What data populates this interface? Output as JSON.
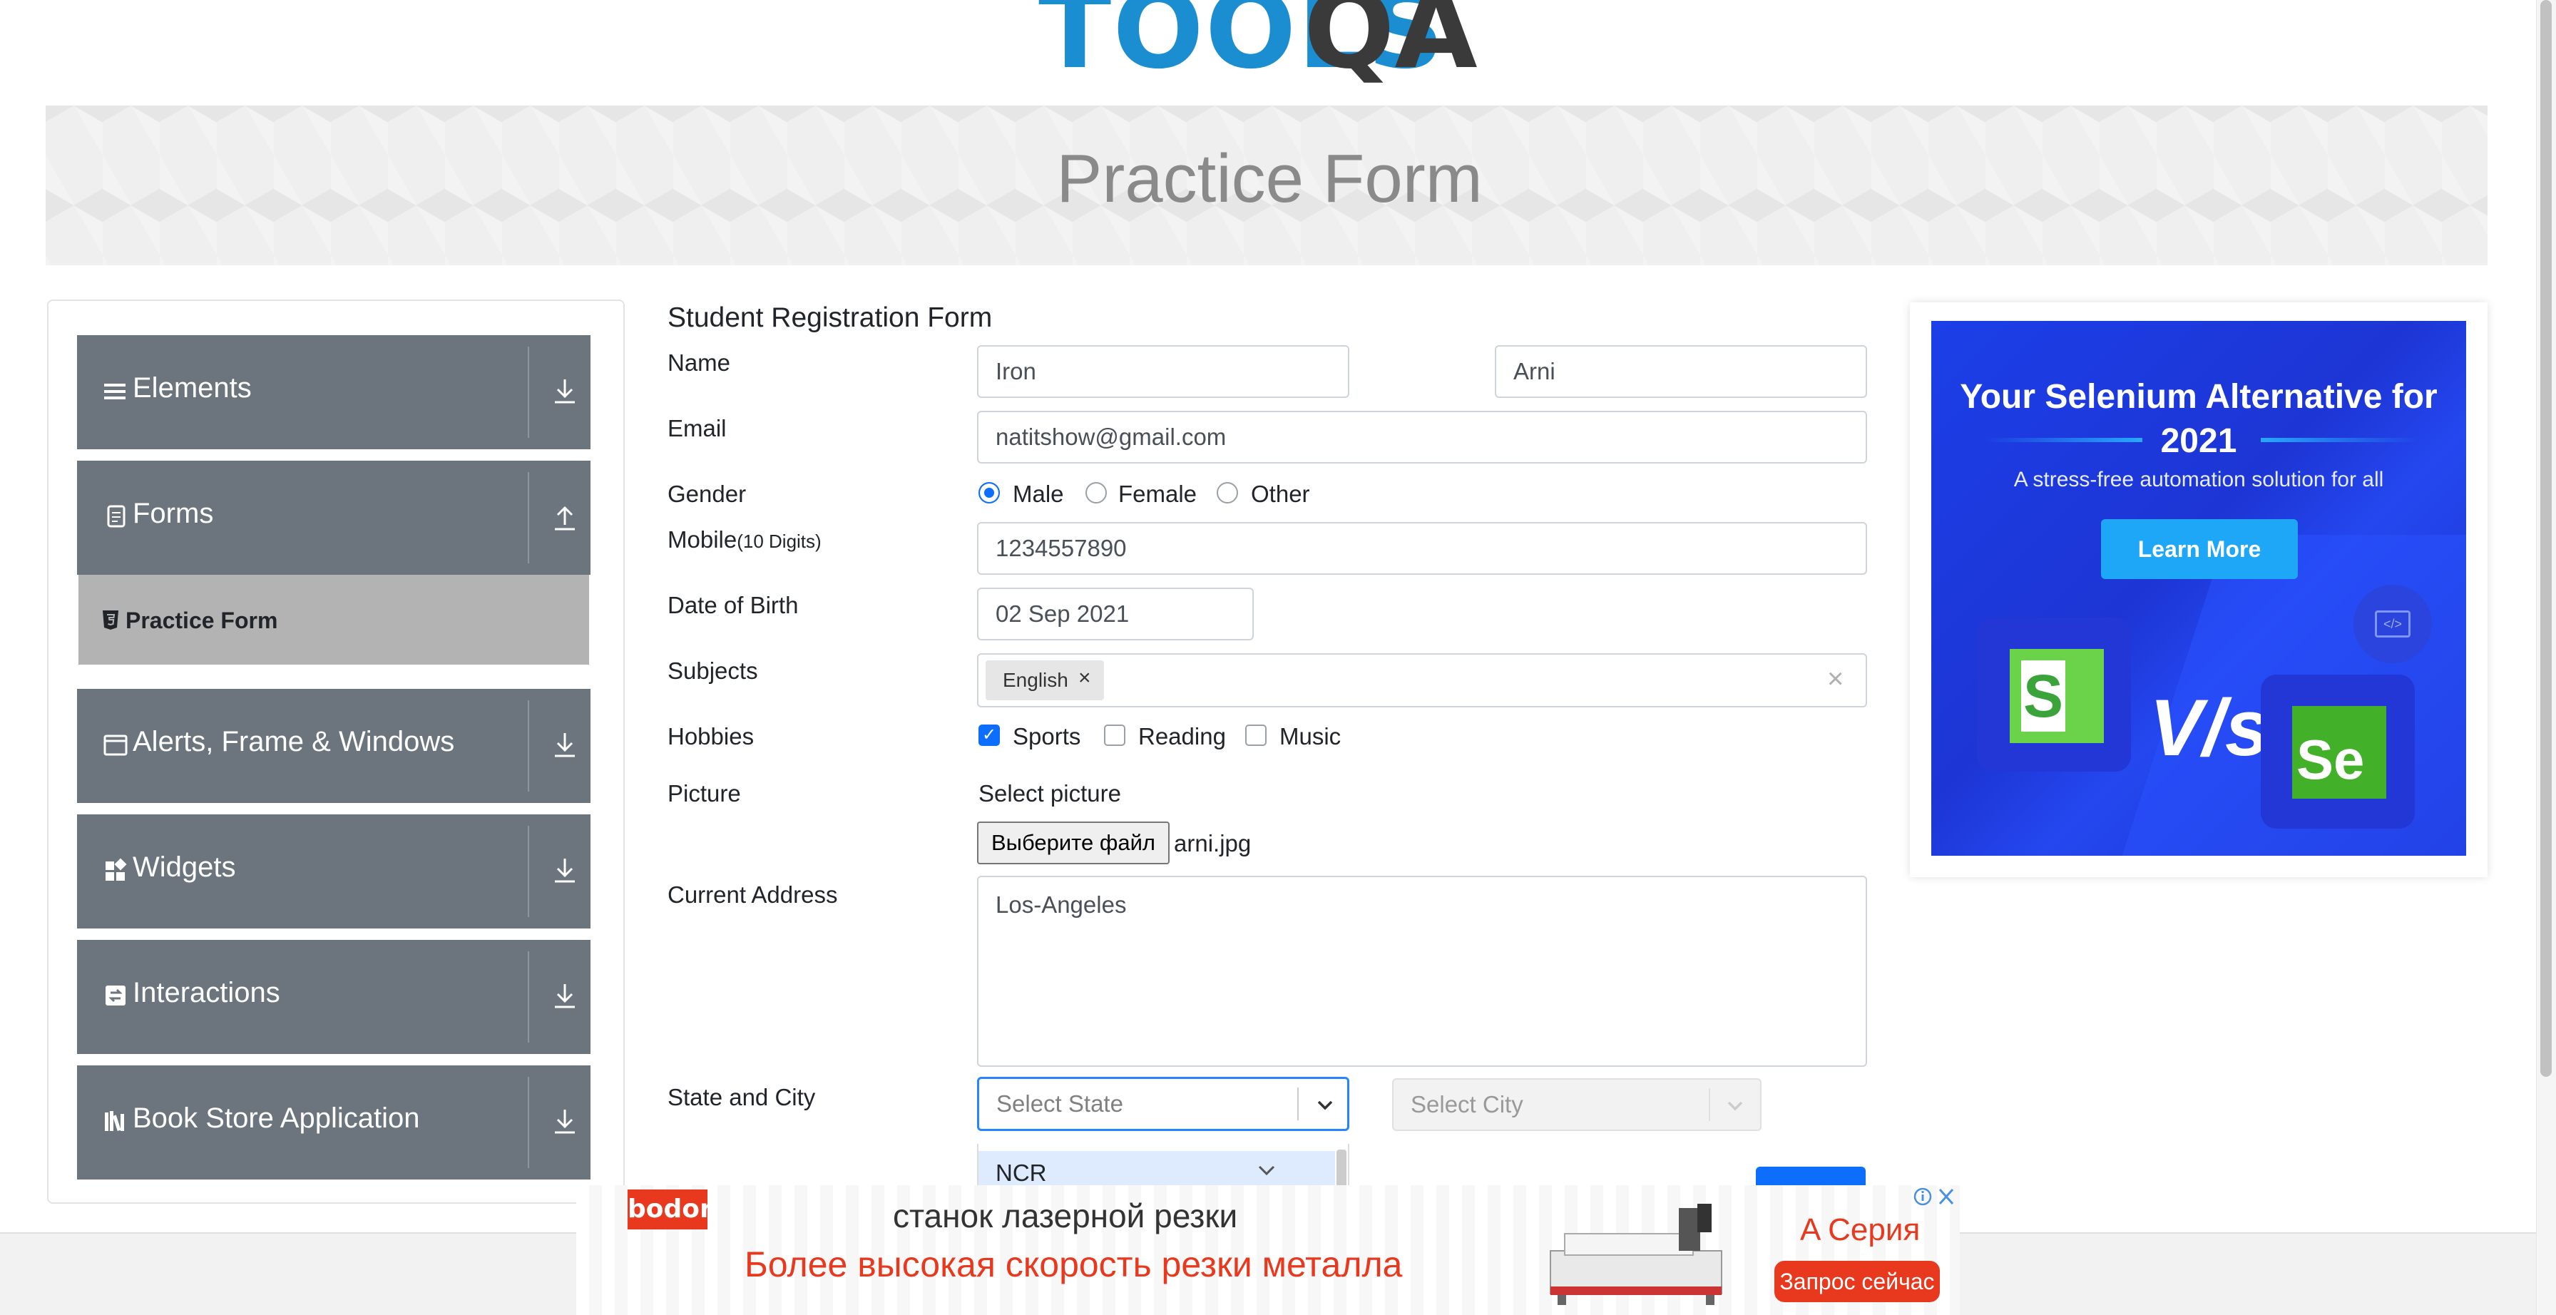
{
  "header": {
    "logo_text_1": "TOOLS",
    "logo_text_2": "QA",
    "page_title": "Practice Form"
  },
  "sidebar": {
    "groups": [
      {
        "label": "Elements",
        "icon": "menu-icon",
        "arrow": "download-icon"
      },
      {
        "label": "Forms",
        "icon": "document-icon",
        "arrow": "upload-icon"
      },
      {
        "label": "Alerts, Frame & Windows",
        "icon": "window-icon",
        "arrow": "download-icon"
      },
      {
        "label": "Widgets",
        "icon": "widgets-icon",
        "arrow": "download-icon"
      },
      {
        "label": "Interactions",
        "icon": "interactions-icon",
        "arrow": "download-icon"
      },
      {
        "label": "Book Store Application",
        "icon": "book-icon",
        "arrow": "download-icon"
      }
    ],
    "active_item": "Practice Form"
  },
  "form": {
    "title": "Student Registration Form",
    "labels": {
      "name": "Name",
      "email": "Email",
      "gender": "Gender",
      "mobile": "Mobile",
      "mobile_hint": "(10 Digits)",
      "dob": "Date of Birth",
      "subjects": "Subjects",
      "hobbies": "Hobbies",
      "picture": "Picture",
      "address": "Current Address",
      "state_city": "State and City"
    },
    "first_name": "Iron",
    "last_name": "Arni",
    "email": "natitshow@gmail.com",
    "gender_options": [
      "Male",
      "Female",
      "Other"
    ],
    "gender_selected": "Male",
    "mobile": "1234557890",
    "dob": "02 Sep 2021",
    "subject_chip": "English",
    "subject_remove": "×",
    "subjects_clear": "×",
    "hobby_options": [
      "Sports",
      "Reading",
      "Music"
    ],
    "hobbies_checked": [
      "Sports"
    ],
    "picture_label": "Select picture",
    "file_button": "Выберите файл",
    "file_name": "arni.jpg",
    "address": "Los-Angeles",
    "state_placeholder": "Select State",
    "city_placeholder": "Select City",
    "state_option_highlighted": "NCR"
  },
  "right_ad": {
    "headline": "Your Selenium Alternative for 2021",
    "subline": "A stress-free automation solution for all",
    "button": "Learn More",
    "versus": "V/s",
    "left_logo": "S",
    "right_logo": "Se"
  },
  "bottom_ad": {
    "brand": "bodor",
    "line1": "станок лазерной резки",
    "line2": "Более высокая скорость резки металла",
    "series": "A Серия",
    "cta": "Запрос сейчас"
  },
  "colors": {
    "sidebar_bg": "#6c757d",
    "sidebar_active": "#b3b3b3",
    "primary": "#0d6efd",
    "logo_blue": "#1b8ed1",
    "ad_blue": "#1d35d4",
    "ad_red": "#e8391e"
  }
}
